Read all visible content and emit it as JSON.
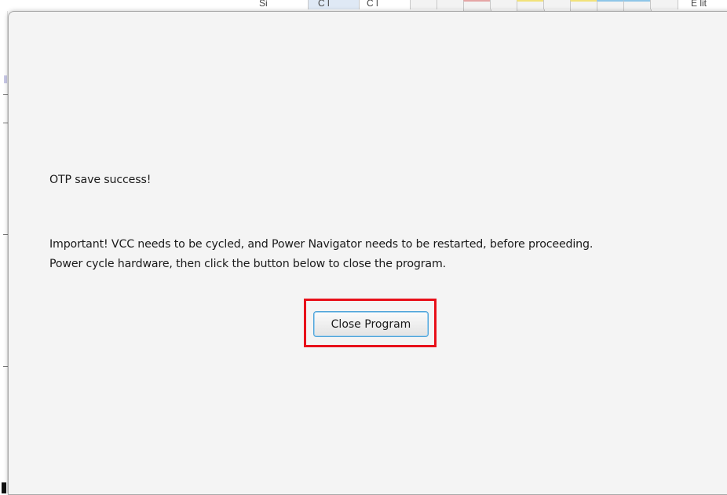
{
  "background": {
    "toolbar_fragments": [
      "Si",
      "C l",
      "C l",
      "E lit"
    ]
  },
  "dialog": {
    "success_message": "OTP save success!",
    "instruction_line1": "Important! VCC needs to be cycled, and Power Navigator needs to be restarted, before proceeding.",
    "instruction_line2": "Power cycle hardware, then click the button below to close the program.",
    "close_button_label": "Close Program"
  },
  "colors": {
    "highlight_border": "#e8101a",
    "button_focus_border": "#4da3d9",
    "dialog_background": "#f4f4f4"
  }
}
